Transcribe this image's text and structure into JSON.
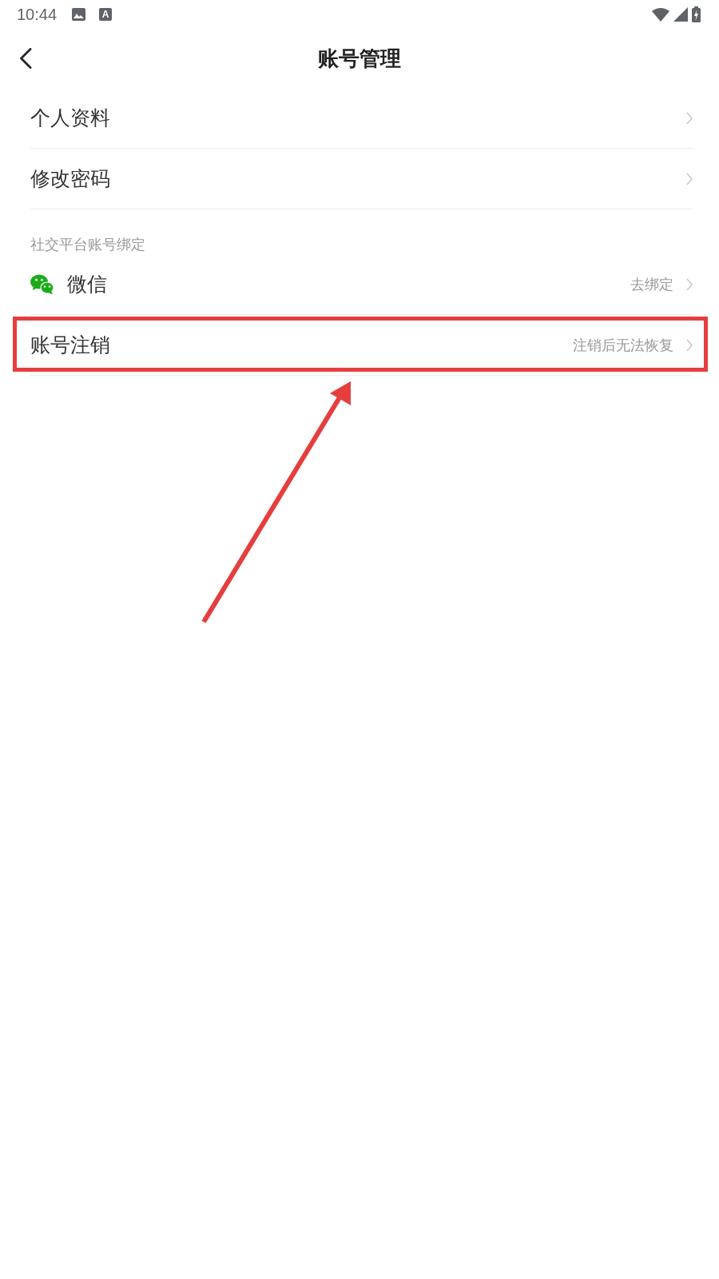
{
  "status_bar": {
    "time": "10:44",
    "notification_badge": "A"
  },
  "header": {
    "title": "账号管理"
  },
  "rows": [
    {
      "kind": "link",
      "label": "个人资料",
      "highlighted": false
    },
    {
      "kind": "link",
      "label": "修改密码",
      "highlighted": false
    },
    {
      "kind": "section",
      "label": "社交平台账号绑定",
      "highlighted": false
    },
    {
      "kind": "wechat",
      "label": "微信",
      "hint": "去绑定",
      "highlighted": false
    },
    {
      "kind": "link",
      "label": "账号注销",
      "hint": "注销后无法恢复",
      "highlighted": true
    }
  ]
}
